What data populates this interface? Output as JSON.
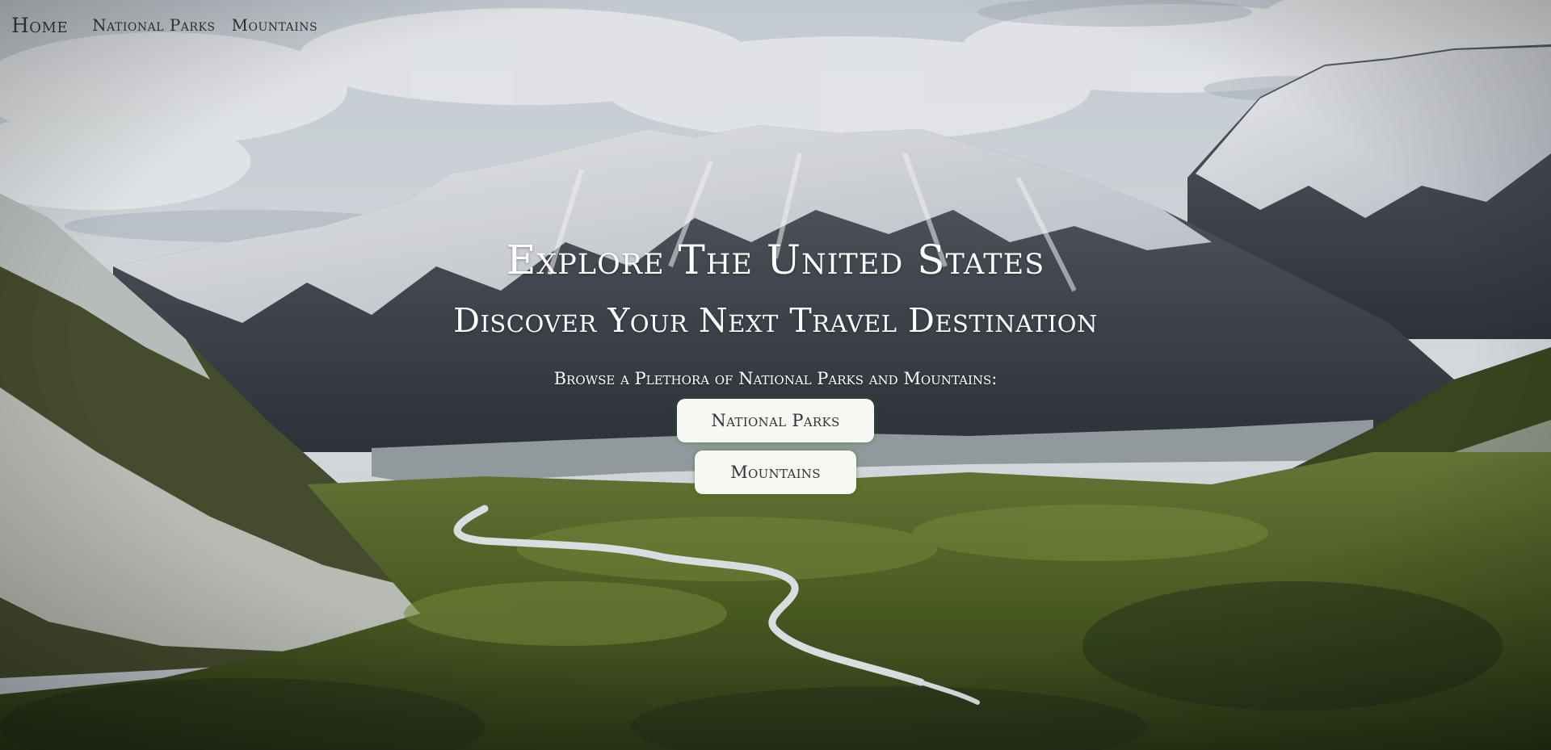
{
  "nav": {
    "home_label": "Home",
    "parks_label": "National Parks",
    "mountains_label": "Mountains"
  },
  "hero": {
    "title": "Explore The United States",
    "subtitle": "Discover Your Next Travel Destination",
    "browse_text": "Browse a Plethora of National Parks and Mountains:",
    "parks_button_label": "National Parks",
    "mountains_button_label": "Mountains"
  },
  "background": {
    "scene": "snow-capped mountain valley with glacial river",
    "colors": {
      "sky": "#d9dfe4",
      "cloud": "#f2f4f6",
      "snow": "#eef1f4",
      "rock": "#3c4149",
      "valley_green": "#55672a",
      "river": "#dfe6e8"
    }
  }
}
